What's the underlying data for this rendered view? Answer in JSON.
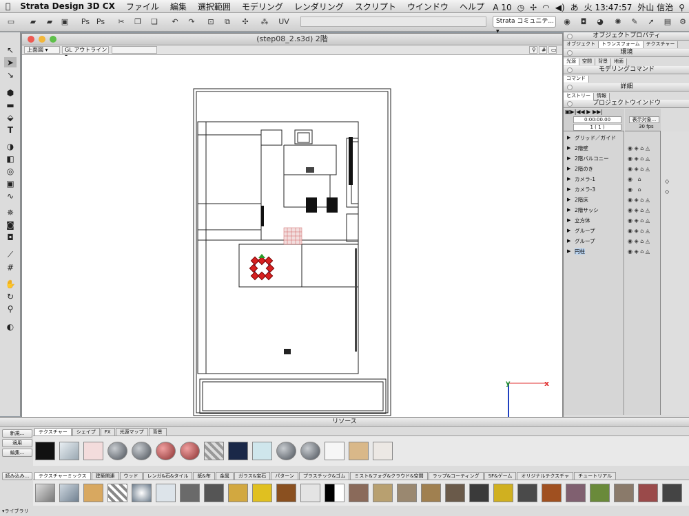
{
  "menubar": {
    "app": "Strata Design 3D CX",
    "items": [
      "ファイル",
      "編集",
      "選択範囲",
      "モデリング",
      "レンダリング",
      "スクリプト",
      "ウインドウ",
      "ヘルプ"
    ],
    "adobe": "10",
    "clock": "火 13:47:57",
    "user": "外山 信治"
  },
  "toolbar": {
    "community": "Strata コミュニテ..."
  },
  "document": {
    "title": "(step08_2.s3d) 2階",
    "view": "上面図",
    "render_mode": "GL アウトライン"
  },
  "panels": {
    "object_props": "オブジェクトプロパティ",
    "obj_tabs": [
      "オブジェクト",
      "トランスフォーム",
      "テクスチャー"
    ],
    "env": "環境",
    "env_tabs": [
      "光源",
      "空間",
      "背景",
      "地面"
    ],
    "modeling": "モデリングコマンド",
    "cmd_tab": "コマンド",
    "detail": "詳細",
    "hist_tabs": [
      "ヒストリー",
      "情報"
    ],
    "project": "プロジェクトウインドウ",
    "time": "0:00:00.00",
    "frame": "1 ( 1 )",
    "display_btn": "表示対象...",
    "fps": "30 fps",
    "layers": [
      "グリッド／ガイド",
      "2階壁",
      "2階バルコニー",
      "2階のき",
      "カメラ-1",
      "カメラ-3",
      "2階床",
      "2階サッシ",
      "立方体",
      "グループ",
      "グループ",
      "円柱"
    ]
  },
  "resources": {
    "title": "リソース",
    "btn_new": "新規...",
    "btn_apply": "適用",
    "btn_edit": "編集...",
    "btn_load": "読み込み...",
    "tabs": [
      "テクスチャー",
      "シェイプ",
      "FX",
      "光源マップ",
      "背景"
    ],
    "lib_tabs": [
      "テクスチャーミックス",
      "建築関連",
      "ウッド",
      "レンガ&石&タイル",
      "紙&布",
      "金属",
      "ガラス&宝石",
      "パターン",
      "プラスチック&ゴム",
      "ミスト&フォグ&クラウド&空間",
      "ラップ&コーティング",
      "SF&ゲーム",
      "オリジナルテクスチャ",
      "チュートリアル"
    ],
    "library": "▾ライブラリ"
  },
  "colors": {
    "accent": "#3a7ee0",
    "axis_x": "#e03030",
    "axis_y": "#209030",
    "axis_z": "#2040c0"
  }
}
